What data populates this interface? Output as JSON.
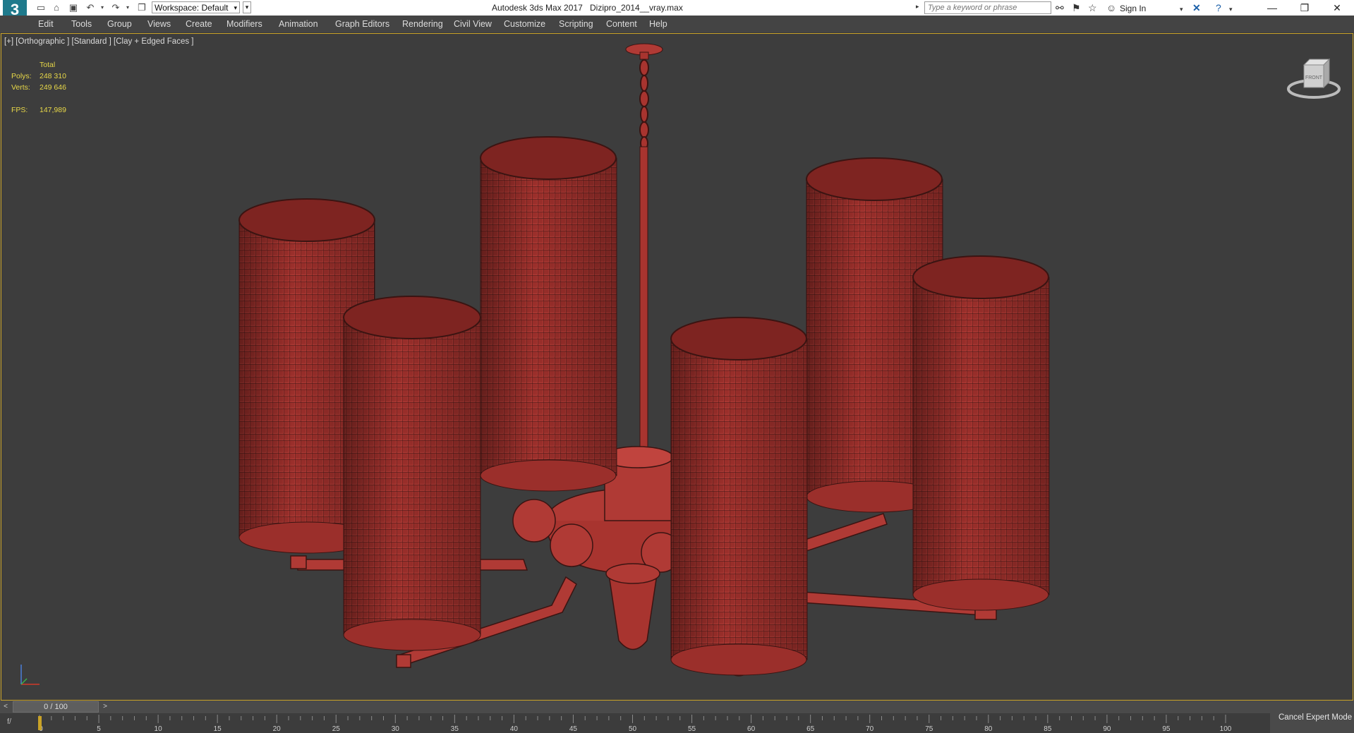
{
  "title_bar": {
    "app_name": "Autodesk 3ds Max 2017",
    "file_name": "Dizipro_2014__vray.max",
    "workspace_label": "Workspace: Default",
    "search_placeholder": "Type a keyword or phrase",
    "sign_in": "Sign In",
    "logo_text": "3"
  },
  "menu": {
    "items": [
      "Edit",
      "Tools",
      "Group",
      "Views",
      "Create",
      "Modifiers",
      "Animation",
      "Graph Editors",
      "Rendering",
      "Civil View",
      "Customize",
      "Scripting",
      "Content",
      "Help"
    ]
  },
  "viewport": {
    "label": "[+] [Orthographic ] [Standard ] [Clay + Edged Faces ]",
    "stats": {
      "total_label": "Total",
      "polys_label": "Polys:",
      "polys_value": "248 310",
      "verts_label": "Verts:",
      "verts_value": "249 646",
      "fps_label": "FPS:",
      "fps_value": "147,989"
    },
    "viewcube_label": "FRONT",
    "accent_color": "#c9a227",
    "model_color": "#b03a35"
  },
  "timeline": {
    "frame_display": "0 / 100",
    "ticks": [
      "0",
      "5",
      "10",
      "15",
      "20",
      "25",
      "30",
      "35",
      "40",
      "45",
      "50",
      "55",
      "60",
      "65",
      "70",
      "75",
      "80",
      "85",
      "90",
      "95",
      "100"
    ]
  },
  "status": {
    "cancel_expert_mode": "Cancel Expert Mode"
  },
  "icons": [
    "app-logo-icon",
    "new-file-icon",
    "open-file-icon",
    "save-icon",
    "undo-icon",
    "redo-icon",
    "project-icon",
    "binoculars-icon",
    "star-icon",
    "user-icon",
    "close-x-icon",
    "help-icon",
    "minimize-icon",
    "maximize-icon",
    "window-close-icon"
  ]
}
